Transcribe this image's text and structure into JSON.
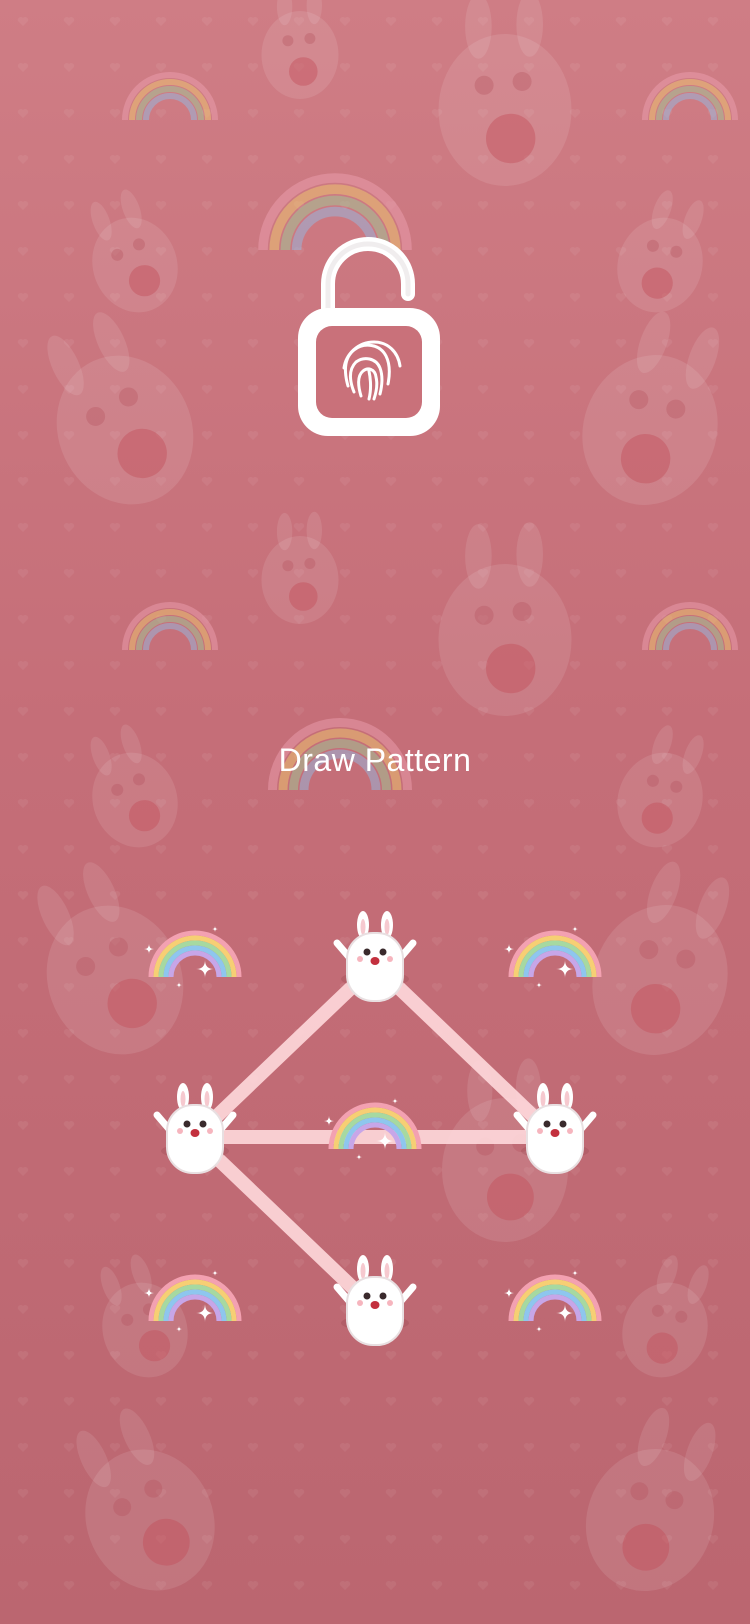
{
  "screen": {
    "title": "Draw Pattern"
  },
  "lock_icon": {
    "name": "unlocked-padlock-fingerprint-icon",
    "color": "#ffffff"
  },
  "pattern": {
    "rows": 3,
    "cols": 3,
    "selected_nodes": [
      1,
      3,
      5,
      7
    ],
    "path_sequence": [
      3,
      1,
      5,
      3,
      7
    ],
    "selected_node_icon": "bunny-icon",
    "unselected_node_icon": "rainbow-sparkle-icon",
    "line_color": "#ffd9dc"
  },
  "colors": {
    "background_top": "#cf7d85",
    "background_bottom": "#bb6670",
    "text": "#ffffff"
  }
}
